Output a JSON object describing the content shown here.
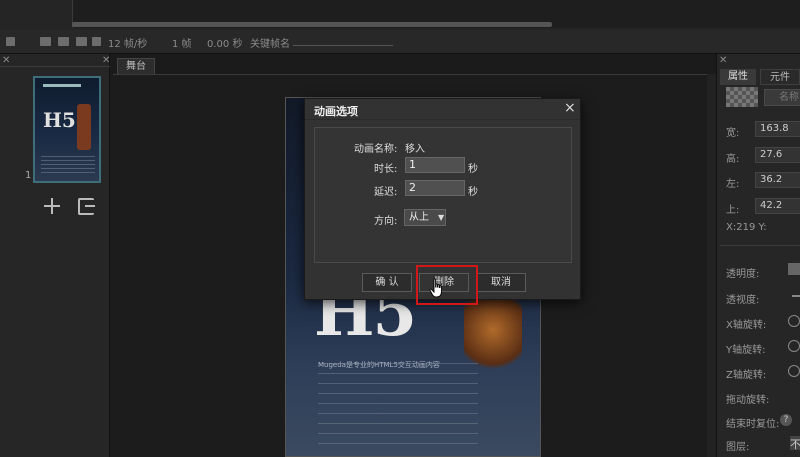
{
  "timeline": {
    "fps": "12 帧/秒",
    "frames": "1 帧",
    "seconds": "0.00 秒",
    "keyframe_name_label": "关键帧名"
  },
  "left_panel": {
    "page_number": "1",
    "thumb_title": "H5"
  },
  "stage": {
    "tab_label": "舞台",
    "canvas_title": "H5",
    "canvas_text_first_line": "Mugeda是专业的HTML5交互动画内容"
  },
  "right_panel": {
    "tabs": [
      "属性",
      "元件"
    ],
    "name_placeholder": "名称",
    "fields": [
      {
        "label": "宽:",
        "value": "163.8"
      },
      {
        "label": "高:",
        "value": "27.6"
      },
      {
        "label": "左:",
        "value": "36.2"
      },
      {
        "label": "上:",
        "value": "42.2"
      }
    ],
    "xy_readout": "X:219   Y:",
    "props": [
      "透明度:",
      "透视度:",
      "X轴旋转:",
      "Y轴旋转:",
      "Z轴旋转:",
      "拖动旋转:",
      "结束时复位:",
      "图层:"
    ],
    "layer_value": "不"
  },
  "dialog": {
    "title": "动画选项",
    "name_label": "动画名称:",
    "name_value": "移入",
    "duration_label": "时长:",
    "duration_value": "1",
    "duration_unit": "秒",
    "delay_label": "延迟:",
    "delay_value": "2",
    "delay_unit": "秒",
    "direction_label": "方向:",
    "direction_value": "从上",
    "confirm_label": "确 认",
    "delete_label": "删除",
    "cancel_label": "取消",
    "close_glyph": "×"
  }
}
